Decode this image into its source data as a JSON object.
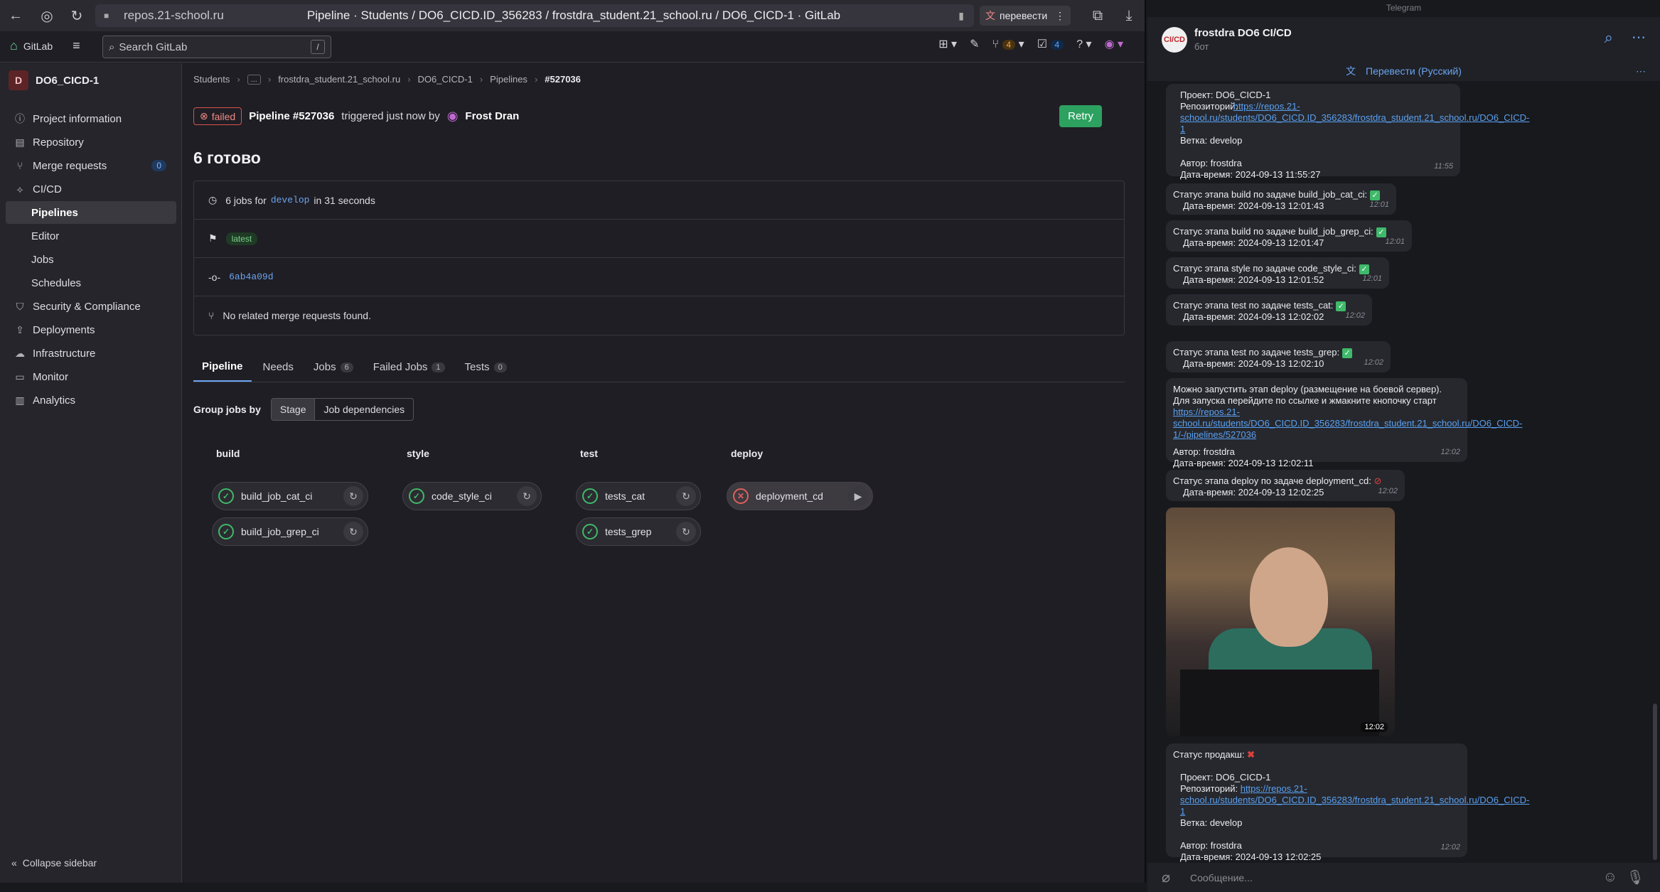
{
  "browser": {
    "url_host": "repos.21-school.ru",
    "page_title": "Pipeline · Students / DO6_CICD.ID_356283 / frostdra_student.21_school.ru / DO6_CICD-1 · GitLab",
    "translate_label": "перевести"
  },
  "gitlab": {
    "brand": "GitLab",
    "search_placeholder": "Search GitLab",
    "search_shortcut": "/",
    "header_mr_count": "4",
    "header_todo_count": "4",
    "project_initial": "D",
    "project_name": "DO6_CICD-1",
    "sidebar": [
      {
        "label": "Project information",
        "icon": "info-icon"
      },
      {
        "label": "Repository",
        "icon": "book-icon"
      },
      {
        "label": "Merge requests",
        "icon": "merge-icon",
        "count": "0"
      },
      {
        "label": "CI/CD",
        "icon": "rocket-icon"
      },
      {
        "label": "Pipelines",
        "sub": true,
        "active": true
      },
      {
        "label": "Editor",
        "sub": true
      },
      {
        "label": "Jobs",
        "sub": true
      },
      {
        "label": "Schedules",
        "sub": true
      },
      {
        "label": "Security & Compliance",
        "icon": "shield-icon"
      },
      {
        "label": "Deployments",
        "icon": "deploy-icon"
      },
      {
        "label": "Infrastructure",
        "icon": "cloud-icon"
      },
      {
        "label": "Monitor",
        "icon": "monitor-icon"
      },
      {
        "label": "Analytics",
        "icon": "chart-icon"
      }
    ],
    "collapse_label": "Collapse sidebar",
    "breadcrumb": [
      "Students",
      "...",
      "frostdra_student.21_school.ru",
      "DO6_CICD-1",
      "Pipelines",
      "#527036"
    ],
    "pipeline": {
      "status": "failed",
      "id_text": "Pipeline #527036",
      "triggered_text": "triggered just now by",
      "user": "Frost Dran",
      "retry_label": "Retry",
      "name": "6 готово",
      "jobs_prefix": "6 jobs for",
      "branch": "develop",
      "jobs_suffix": "in 31 seconds",
      "tag": "latest",
      "commit": "6ab4a09d",
      "mr_text": "No related merge requests found."
    },
    "tabs": [
      {
        "label": "Pipeline",
        "active": true
      },
      {
        "label": "Needs"
      },
      {
        "label": "Jobs",
        "count": "6"
      },
      {
        "label": "Failed Jobs",
        "count": "1"
      },
      {
        "label": "Tests",
        "count": "0"
      }
    ],
    "group_by_label": "Group jobs by",
    "group_by_options": [
      "Stage",
      "Job dependencies"
    ],
    "stages": [
      {
        "name": "build",
        "jobs": [
          {
            "name": "build_job_cat_ci",
            "status": "success"
          },
          {
            "name": "build_job_grep_ci",
            "status": "success"
          }
        ]
      },
      {
        "name": "style",
        "jobs": [
          {
            "name": "code_style_ci",
            "status": "success"
          }
        ]
      },
      {
        "name": "test",
        "jobs": [
          {
            "name": "tests_cat",
            "status": "success"
          },
          {
            "name": "tests_grep",
            "status": "success"
          }
        ]
      },
      {
        "name": "deploy",
        "jobs": [
          {
            "name": "deployment_cd",
            "status": "failed"
          }
        ]
      }
    ]
  },
  "telegram": {
    "top_label": "Telegram",
    "chat_name": "frostdra DO6 CI/CD",
    "chat_sub": "бот",
    "avatar_text": "CI/CD",
    "translate_bar": "Перевести (Русский)",
    "input_placeholder": "Сообщение...",
    "msg1": {
      "l1": "Проект: DO6_CICD-1",
      "l2": "Репозиторий:",
      "link": "https://repos.21-school.ru/students/DO6_CICD.ID_356283/frostdra_student.21_school.ru/DO6_CICD-1",
      "l3": "Ветка: develop",
      "l4": "Автор: frostdra",
      "l5": "Дата-время: 2024-09-13 11:55:27",
      "time": "11:55"
    },
    "stage_msgs": [
      {
        "text": "Статус этапа  build по задаче build_job_cat_ci:",
        "date": "Дата-время: 2024-09-13 12:01:43",
        "time": "12:01"
      },
      {
        "text": "Статус этапа  build по задаче build_job_grep_ci:",
        "date": "Дата-время: 2024-09-13 12:01:47",
        "time": "12:01"
      },
      {
        "text": "Статус этапа  style по задаче code_style_ci:",
        "date": "Дата-время: 2024-09-13 12:01:52",
        "time": "12:01"
      },
      {
        "text": "Статус этапа  test по задаче tests_cat:",
        "date": "Дата-время: 2024-09-13 12:02:02",
        "time": "12:02"
      },
      {
        "text": "Статус этапа  test по задаче tests_grep:",
        "date": "Дата-время: 2024-09-13 12:02:10",
        "time": "12:02"
      }
    ],
    "deploy_prompt": {
      "l1": "Можно запустить этап deploy (размещение на боевой сервер).",
      "l2": "Для запуска перейдите по ссылке и жмакните кнопочку старт",
      "link": "https://repos.21-school.ru/students/DO6_CICD.ID_356283/frostdra_student.21_school.ru/DO6_CICD-1/-/pipelines/527036",
      "l3": "Автор: frostdra",
      "l4": "Дата-время: 2024-09-13 12:02:11",
      "time": "12:02"
    },
    "deploy_status": {
      "text": "Статус этапа  deploy по задаче deployment_cd:",
      "date": "Дата-время: 2024-09-13 12:02:25",
      "time": "12:02"
    },
    "image_time": "12:02",
    "final_msg": {
      "l0": "Статус продакш:",
      "l1": "Проект: DO6_CICD-1",
      "l2": "Репозиторий:",
      "link": "https://repos.21-school.ru/students/DO6_CICD.ID_356283/frostdra_student.21_school.ru/DO6_CICD-1",
      "l3": "Ветка: develop",
      "l4": "Автор: frostdra",
      "l5": "Дата-время: 2024-09-13 12:02:25",
      "time": "12:02"
    }
  }
}
